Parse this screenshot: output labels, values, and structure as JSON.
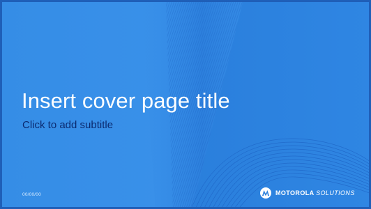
{
  "slide": {
    "title": "Insert cover page title",
    "subtitle": "Click to add subtitle",
    "date": "00/00/00",
    "brand": {
      "name_bold": "MOTOROLA",
      "name_light": "SOLUTIONS",
      "logo_icon": "motorola-batwing-icon"
    }
  },
  "colors": {
    "background": "#358de6",
    "title": "#ffffff",
    "subtitle": "#0b2a6f",
    "border": "#1f5fb8"
  }
}
